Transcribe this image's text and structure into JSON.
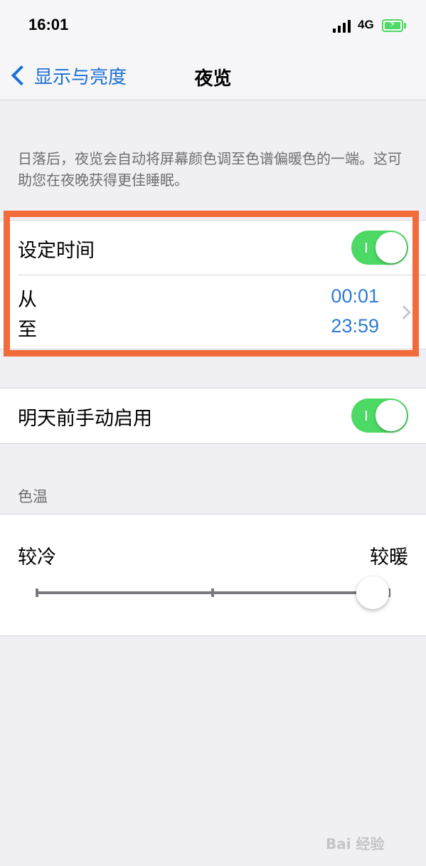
{
  "status_bar": {
    "time": "16:01",
    "network": "4G",
    "battery_icon": "charging-battery",
    "battery_color": "#4cd964"
  },
  "nav": {
    "back_label": "显示与亮度",
    "title": "夜览",
    "accent_color": "#1a6fd6"
  },
  "description": "日落后，夜览会自动将屏幕颜色调至色谱偏暖色的一端。这可助您在夜晚获得更佳睡眠。",
  "schedule": {
    "label": "设定时间",
    "toggle_on": true,
    "from_label": "从",
    "to_label": "至",
    "from_time": "00:01",
    "to_time": "23:59",
    "highlight_color": "#f26b3a"
  },
  "manual": {
    "label": "明天前手动启用",
    "toggle_on": true
  },
  "color_temp": {
    "section_header": "色温",
    "cooler_label": "较冷",
    "warmer_label": "较暖",
    "slider_value_fraction": 1.0
  },
  "watermark": "Bai 经验"
}
